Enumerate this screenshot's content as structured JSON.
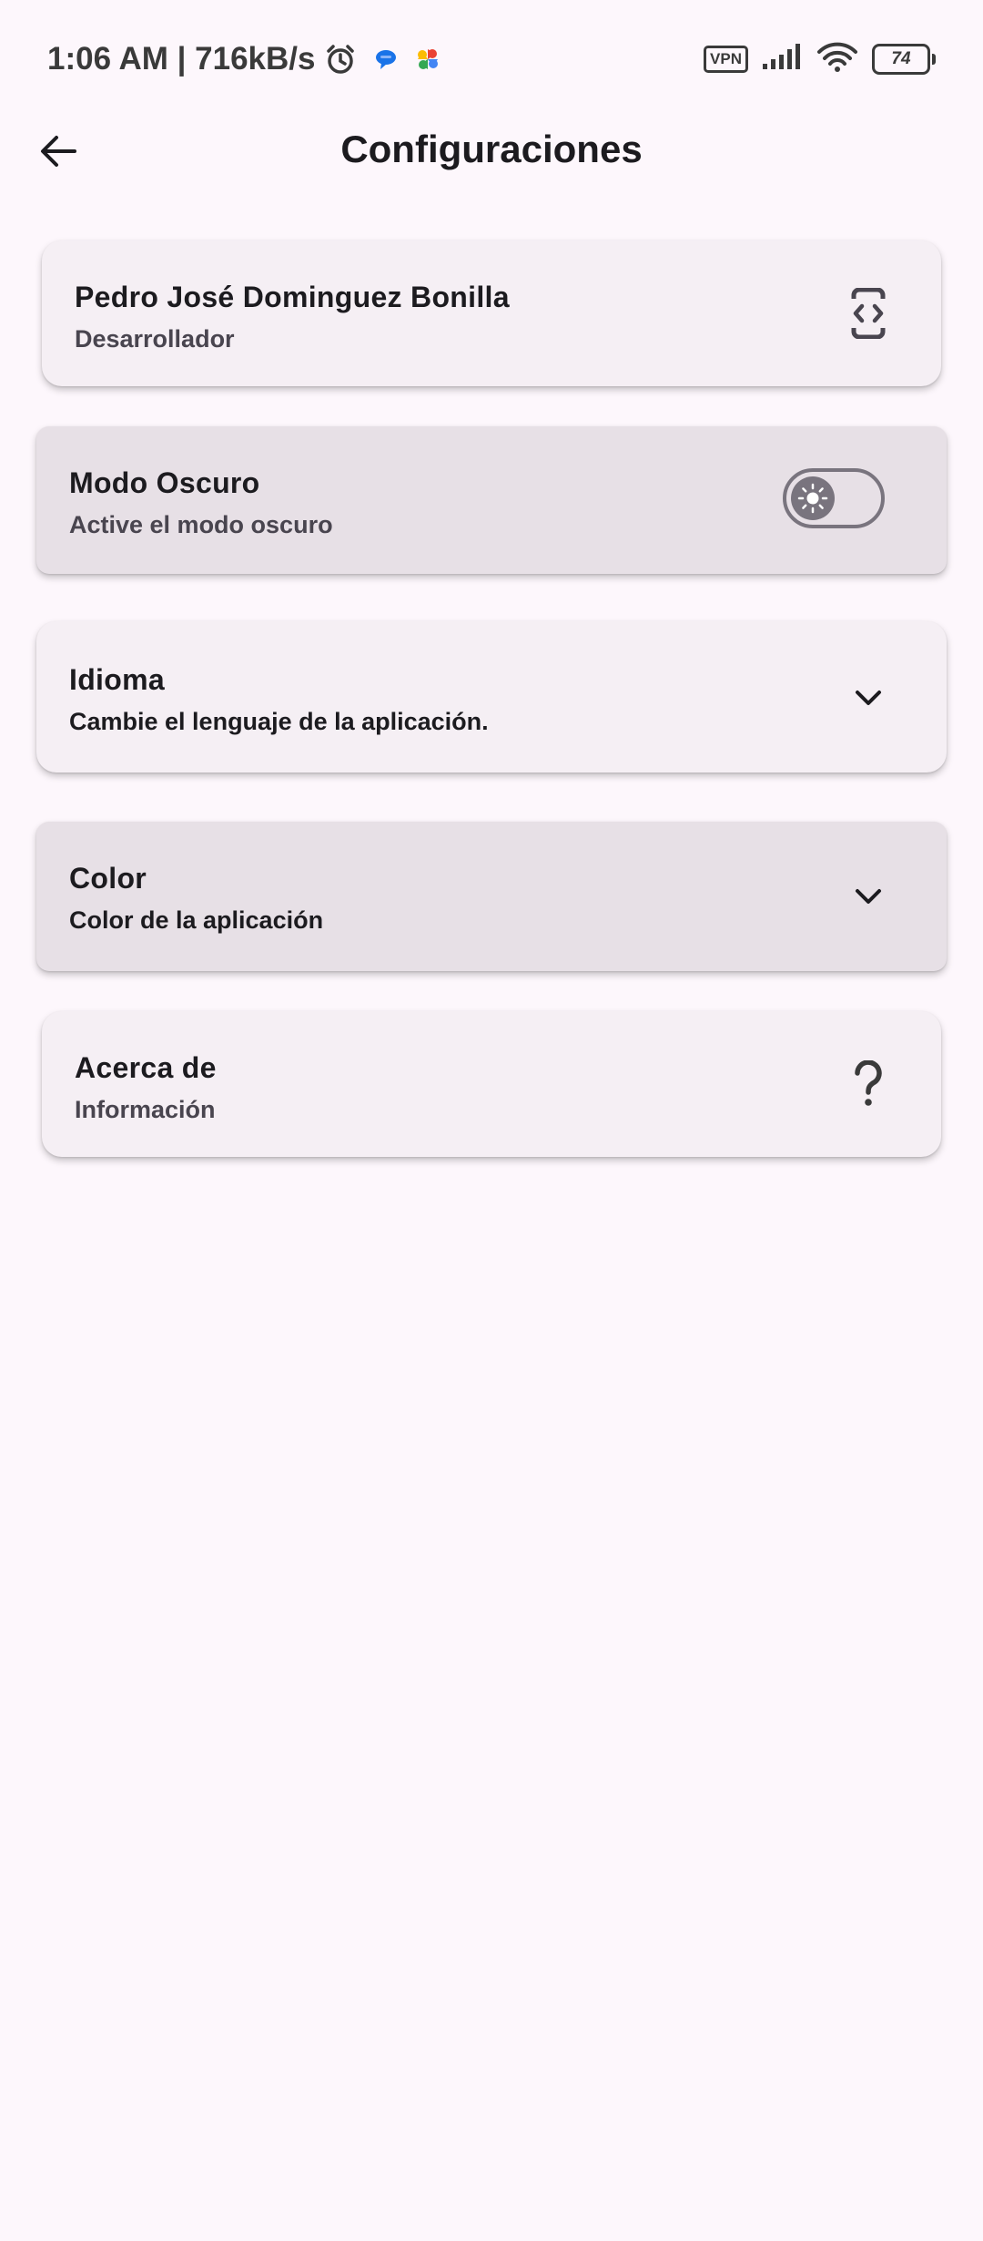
{
  "status_bar": {
    "time_speed": "1:06 AM | 716kB/s",
    "vpn": "VPN",
    "battery": "74",
    "icons": [
      "alarm-icon",
      "messages-icon",
      "photos-icon",
      "signal-icon",
      "wifi-icon",
      "battery-icon"
    ]
  },
  "app_bar": {
    "title": "Configuraciones",
    "back_icon": "arrow-left-icon"
  },
  "settings": {
    "profile": {
      "title": "Pedro José Dominguez Bonilla",
      "subtitle": "Desarrollador",
      "icon": "developer-mode-icon"
    },
    "dark_mode": {
      "title": "Modo Oscuro",
      "subtitle": "Active el modo oscuro",
      "enabled": false,
      "icon": "sun-icon"
    },
    "language": {
      "title": "Idioma",
      "subtitle": "Cambie el lenguaje de la aplicación.",
      "icon": "chevron-down-icon"
    },
    "color": {
      "title": "Color",
      "subtitle": "Color de la aplicación",
      "icon": "chevron-down-icon"
    },
    "about": {
      "title": "Acerca de",
      "subtitle": "Información",
      "icon": "help-icon"
    }
  },
  "colors": {
    "background": "#fdf7fc",
    "card": "#f5eff4",
    "card_expandable": "#e7e0e6",
    "text_primary": "#1c1b1f",
    "text_secondary": "#49454f",
    "toggle_outline": "#79747e"
  }
}
